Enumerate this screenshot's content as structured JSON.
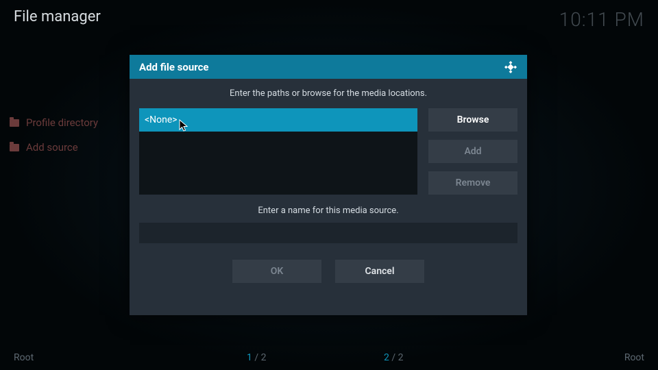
{
  "header": {
    "title": "File manager",
    "clock": "10:11 PM"
  },
  "sidebar": {
    "items": [
      {
        "label": "Profile directory"
      },
      {
        "label": "Add source"
      }
    ]
  },
  "dialog": {
    "title": "Add file source",
    "instruction_paths": "Enter the paths or browse for the media locations.",
    "path_selected": "<None>",
    "buttons": {
      "browse": "Browse",
      "add": "Add",
      "remove": "Remove"
    },
    "instruction_name": "Enter a name for this media source.",
    "name_value": "",
    "ok": "OK",
    "cancel": "Cancel"
  },
  "footer": {
    "root_left": "Root",
    "root_right": "Root",
    "page_left_cur": "1",
    "page_left_tot": "2",
    "page_right_cur": "2",
    "page_right_tot": "2",
    "sep": " / "
  }
}
